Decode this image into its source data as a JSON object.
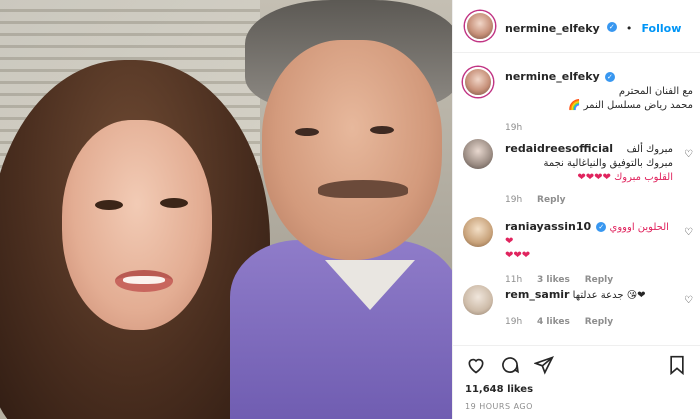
{
  "header": {
    "username": "nermine_elfeky",
    "follow_label": "Follow",
    "separator": "•"
  },
  "caption": {
    "username": "nermine_elfeky",
    "line1": "مع الفنان المحترم",
    "line2": "محمد رياض مسلسل النمر 🌈",
    "time": "19h"
  },
  "comments": [
    {
      "username": "redaidreesofficial",
      "text1": "مبروك ألف",
      "text2": "مبروك بالتوفيق والنياغالية نجمة",
      "text3": "القلوب مبروك ❤❤❤❤",
      "time": "19h",
      "likes": "",
      "reply": "Reply"
    },
    {
      "username": "raniayassin10",
      "text1": "الحلوين اوووي❤",
      "text2": "❤❤❤",
      "time": "11h",
      "likes": "3 likes",
      "reply": "Reply"
    },
    {
      "username": "rem_samir",
      "text1": "جدعة عدلتها 😘❤",
      "time": "19h",
      "likes": "4 likes",
      "reply": "Reply"
    }
  ],
  "actions": {
    "likes": "11,648 likes",
    "time_ago": "19 HOURS AGO"
  },
  "icons": [
    "heart-icon",
    "comment-icon",
    "share-icon",
    "bookmark-icon"
  ],
  "colors": {
    "follow": "#0095f6",
    "verified": "#3897f0",
    "heart": "#e0245e"
  }
}
